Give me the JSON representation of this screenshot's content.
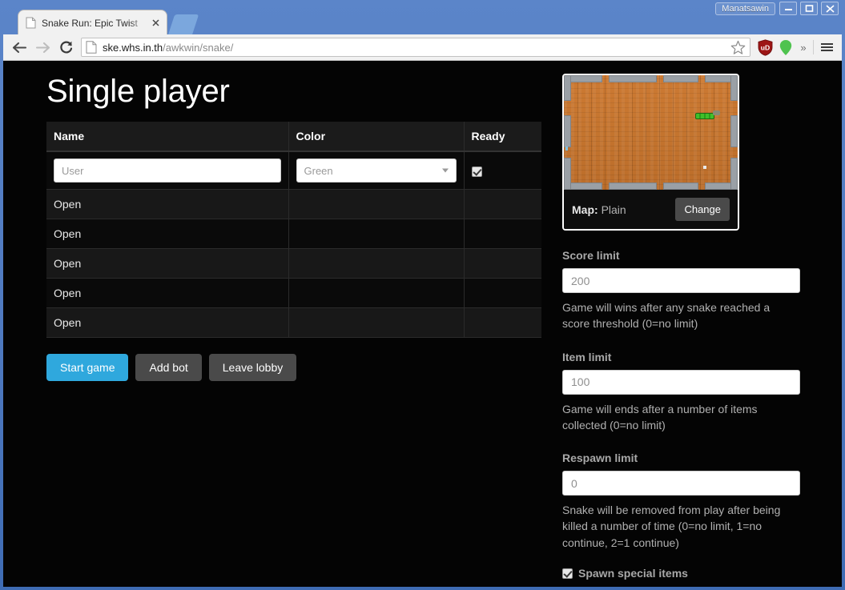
{
  "browser": {
    "titlebar": {
      "user_badge": "Manatsawin",
      "minimize_label": "Minimize",
      "maximize_label": "Maximize",
      "close_label": "Close"
    },
    "tab": {
      "title": "Snake Run: Epic Twist",
      "close_label": "Close tab",
      "new_tab_label": "New tab"
    },
    "toolbar": {
      "back_label": "Back",
      "forward_label": "Forward",
      "reload_label": "Reload",
      "url_domain": "ske.whs.in.th",
      "url_path": "/awkwin/snake/",
      "bookmark_label": "Bookmark this page",
      "extension_1": "ublock-origin-icon",
      "extension_2": "location-pin-icon",
      "overflow_label": "»",
      "menu_label": "Customize and control"
    }
  },
  "page": {
    "title": "Single player",
    "table": {
      "headers": [
        "Name",
        "Color",
        "Ready"
      ],
      "player_row": {
        "name_value": "",
        "name_placeholder": "User",
        "color_value": "Green",
        "ready_checked": true
      },
      "open_slots": [
        "Open",
        "Open",
        "Open",
        "Open",
        "Open"
      ]
    },
    "buttons": {
      "start_game": "Start game",
      "add_bot": "Add bot",
      "leave_lobby": "Leave lobby"
    },
    "map_card": {
      "label_prefix": "Map:",
      "map_name": "Plain",
      "change_button": "Change"
    },
    "settings": {
      "score_limit": {
        "label": "Score limit",
        "value": "200",
        "help": "Game will wins after any snake reached a score threshold (0=no limit)"
      },
      "item_limit": {
        "label": "Item limit",
        "value": "100",
        "help": "Game will ends after a number of items collected (0=no limit)"
      },
      "respawn_limit": {
        "label": "Respawn limit",
        "value": "0",
        "help": "Snake will be removed from play after being killed a number of time (0=no limit, 1=no continue, 2=1 continue)"
      },
      "spawn_special_items": {
        "label": "Spawn special items",
        "checked": true
      }
    }
  },
  "colors": {
    "accent": "#2fa8dd",
    "page_bg": "#040404",
    "chrome_bg": "#f1f1f1",
    "frame_blue": "#4a72b8",
    "map_floor": "#c4742e",
    "map_wall": "#9aa0a6",
    "snake_green": "#3fbf2a"
  }
}
